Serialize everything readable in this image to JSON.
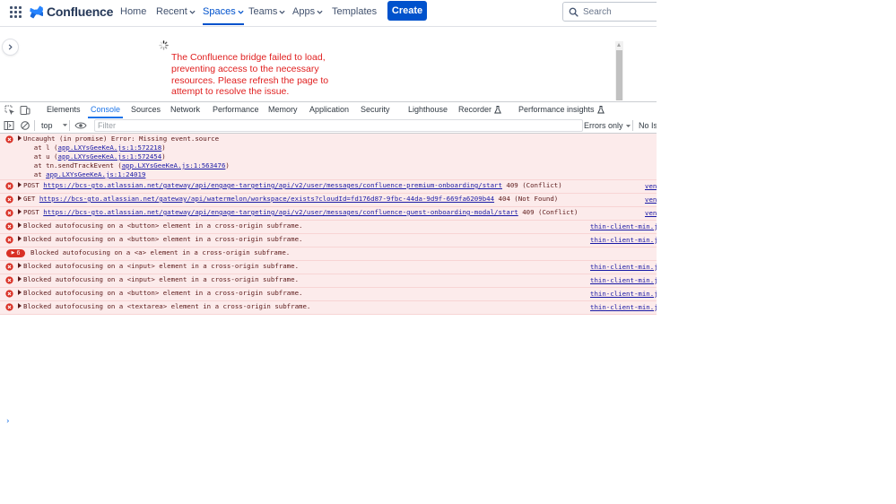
{
  "topnav": {
    "logo_text": "Confluence",
    "items": [
      {
        "label": "Home",
        "has_caret": false,
        "active": false
      },
      {
        "label": "Recent",
        "has_caret": true,
        "active": false
      },
      {
        "label": "Spaces",
        "has_caret": true,
        "active": true
      },
      {
        "label": "Teams",
        "has_caret": true,
        "active": false
      },
      {
        "label": "Apps",
        "has_caret": true,
        "active": false
      },
      {
        "label": "Templates",
        "has_caret": false,
        "active": false
      }
    ],
    "create_label": "Create",
    "search_placeholder": "Search"
  },
  "page": {
    "error_message": "The Confluence bridge failed to load, preventing access to the necessary resources. Please refresh the page to attempt to resolve the issue."
  },
  "devtools": {
    "tabs": [
      {
        "label": "Elements",
        "active": false,
        "flask": false
      },
      {
        "label": "Console",
        "active": true,
        "flask": false
      },
      {
        "label": "Sources",
        "active": false,
        "flask": false
      },
      {
        "label": "Network",
        "active": false,
        "flask": false
      },
      {
        "label": "Performance",
        "active": false,
        "flask": false
      },
      {
        "label": "Memory",
        "active": false,
        "flask": false
      },
      {
        "label": "Application",
        "active": false,
        "flask": false
      },
      {
        "label": "Security",
        "active": false,
        "flask": false
      },
      {
        "label": "Lighthouse",
        "active": false,
        "flask": false
      },
      {
        "label": "Recorder",
        "active": false,
        "flask": true
      },
      {
        "label": "Performance insights",
        "active": false,
        "flask": true
      }
    ],
    "toolbar": {
      "context": "top",
      "filter_placeholder": "Filter",
      "levels": "Errors only",
      "issues": "No Is"
    },
    "console": {
      "rows": [
        {
          "lines": [
            {
              "parts": [
                {
                  "text": "Uncaught (in promise) Error: Missing event.source"
                }
              ],
              "triangle": true
            },
            {
              "parts": [
                {
                  "text": "    at l ("
                },
                {
                  "text": "app.LXYsGeeKeA.js:1:572218",
                  "link": true
                },
                {
                  "text": ")"
                }
              ]
            },
            {
              "parts": [
                {
                  "text": "    at u ("
                },
                {
                  "text": "app.LXYsGeeKeA.js:1:572454",
                  "link": true
                },
                {
                  "text": ")"
                }
              ]
            },
            {
              "parts": [
                {
                  "text": "    at tn.sendTrackEvent ("
                },
                {
                  "text": "app.LXYsGeeKeA.js:1:563476",
                  "link": true
                },
                {
                  "text": ")"
                }
              ]
            },
            {
              "parts": [
                {
                  "text": "    at "
                },
                {
                  "text": "app.LXYsGeeKeA.js:1:24019",
                  "link": true
                }
              ]
            }
          ]
        },
        {
          "lines": [
            {
              "triangle": true,
              "parts": [
                {
                  "text": "POST "
                },
                {
                  "text": "https://bcs-gto.atlassian.net/gateway/api/engage-targeting/api/v2/user/messages/confluence-premium-onboarding/start",
                  "link": true
                },
                {
                  "text": " 409 (Conflict)"
                }
              ]
            }
          ],
          "source": "ven"
        },
        {
          "lines": [
            {
              "triangle": true,
              "parts": [
                {
                  "text": "GET "
                },
                {
                  "text": "https://bcs-gto.atlassian.net/gateway/api/watermelon/workspace/exists?cloudId=fd176d87-9fbc-44da-9d9f-669fa6209b44",
                  "link": true
                },
                {
                  "text": " 404 (Not Found)"
                }
              ]
            }
          ],
          "source": "ven"
        },
        {
          "lines": [
            {
              "triangle": true,
              "parts": [
                {
                  "text": "POST "
                },
                {
                  "text": "https://bcs-gto.atlassian.net/gateway/api/engage-targeting/api/v2/user/messages/confluence-guest-onboarding-modal/start",
                  "link": true
                },
                {
                  "text": " 409 (Conflict)"
                }
              ]
            }
          ],
          "source": "ven"
        },
        {
          "lines": [
            {
              "triangle": true,
              "parts": [
                {
                  "text": "Blocked autofocusing on a <button> element in a cross-origin subframe."
                }
              ]
            }
          ],
          "source": "thin-client-min.j"
        },
        {
          "lines": [
            {
              "triangle": true,
              "parts": [
                {
                  "text": "Blocked autofocusing on a <button> element in a cross-origin subframe."
                }
              ]
            }
          ],
          "source": "thin-client-min.j"
        },
        {
          "badge": "6",
          "lines": [
            {
              "triangle": false,
              "parts": [
                {
                  "text": "Blocked autofocusing on a <a> element in a cross-origin subframe."
                }
              ]
            }
          ]
        },
        {
          "lines": [
            {
              "triangle": true,
              "parts": [
                {
                  "text": "Blocked autofocusing on a <input> element in a cross-origin subframe."
                }
              ]
            }
          ],
          "source": "thin-client-min.j"
        },
        {
          "lines": [
            {
              "triangle": true,
              "parts": [
                {
                  "text": "Blocked autofocusing on a <input> element in a cross-origin subframe."
                }
              ]
            }
          ],
          "source": "thin-client-min.j"
        },
        {
          "lines": [
            {
              "triangle": true,
              "parts": [
                {
                  "text": "Blocked autofocusing on a <button> element in a cross-origin subframe."
                }
              ]
            }
          ],
          "source": "thin-client-min.j"
        },
        {
          "lines": [
            {
              "triangle": true,
              "parts": [
                {
                  "text": "Blocked autofocusing on a <textarea> element in a cross-origin subframe."
                }
              ]
            }
          ],
          "source": "thin-client-min.j"
        }
      ],
      "prompt": "›"
    }
  }
}
